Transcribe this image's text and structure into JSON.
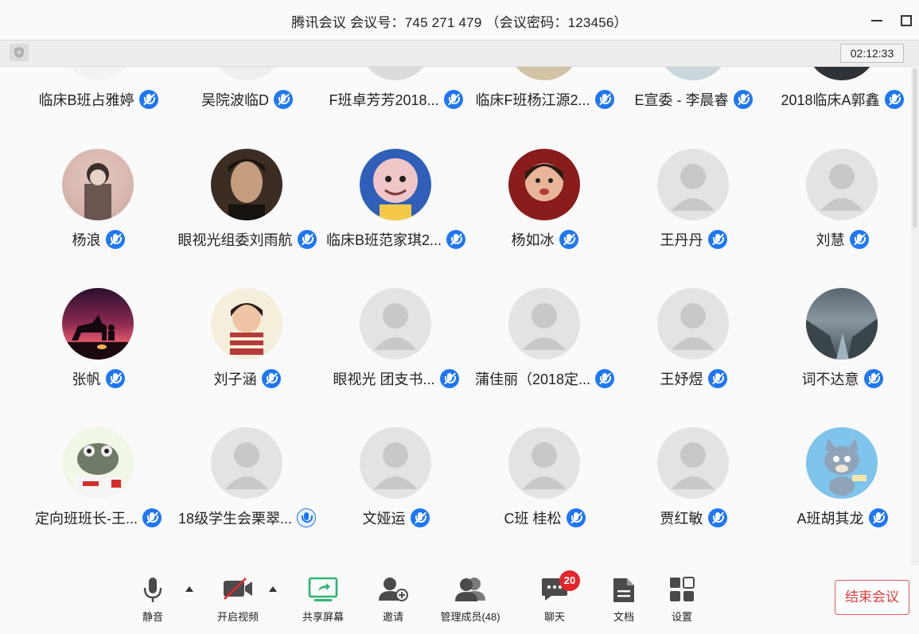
{
  "window": {
    "title": "腾讯会议 会议号：745 271 479 （会议密码：123456）",
    "timer": "02:12:33"
  },
  "rows": [
    [
      "临床B班占雅婷",
      "吴院波临D",
      "F班卓芳芳2018...",
      "临床F班杨江源2...",
      "E宣委 - 李晨睿",
      "2018临床A郭鑫"
    ],
    [
      "杨浪",
      "眼视光组委刘雨航",
      "临床B班范家琪2...",
      "杨如冰",
      "王丹丹",
      "刘慧"
    ],
    [
      "张帆",
      "刘子涵",
      "眼视光 团支书...",
      "蒲佳丽（2018定...",
      "王妤煜",
      "词不达意"
    ],
    [
      "定向班班长-王...",
      "18级学生会栗翠...",
      "文娅运",
      "C班 桂松",
      "贾红敏",
      "A班胡其龙"
    ]
  ],
  "toolbar": {
    "mute": "静音",
    "video": "开启视频",
    "share": "共享屏幕",
    "invite": "邀请",
    "members": "管理成员(48)",
    "chat": "聊天",
    "chat_badge": "20",
    "docs": "文档",
    "settings": "设置",
    "end": "结束会议"
  },
  "colors": {
    "accent": "#1e77f5",
    "end_red": "#e03e3e",
    "badge_red": "#e5252a",
    "share_green": "#2bb673"
  }
}
